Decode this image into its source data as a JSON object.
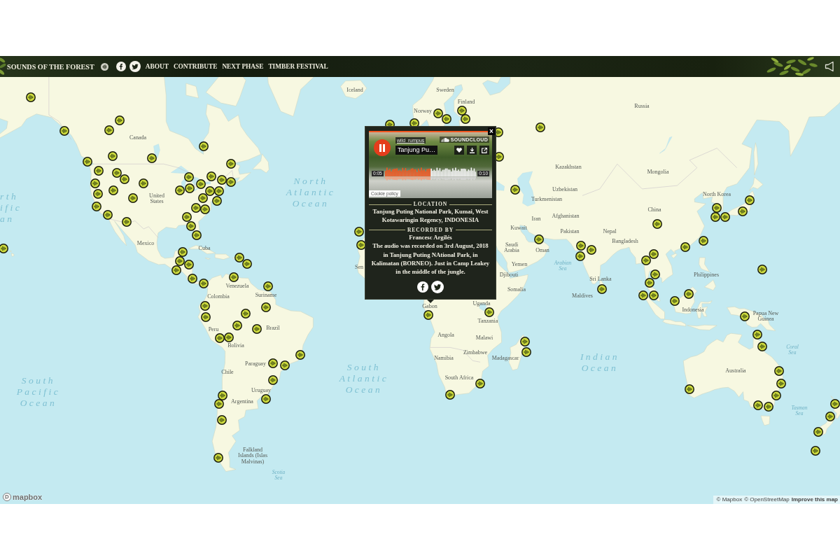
{
  "topbar": {
    "title": "SOUNDS OF THE FOREST",
    "nav": [
      {
        "label": "ABOUT"
      },
      {
        "label": "CONTRIBUTE"
      },
      {
        "label": "NEXT PHASE"
      },
      {
        "label": "TIMBER FESTIVAL"
      }
    ]
  },
  "map": {
    "labels": [
      {
        "text": "Iceland",
        "kind": "country"
      },
      {
        "text": "Sweden",
        "kind": "country"
      },
      {
        "text": "Finland",
        "kind": "country"
      },
      {
        "text": "Russia",
        "kind": "country"
      },
      {
        "text": "Norway",
        "kind": "country"
      },
      {
        "text": "Canada",
        "kind": "country"
      },
      {
        "text": "Kazakhstan",
        "kind": "country"
      },
      {
        "text": "Mongolia",
        "kind": "country"
      },
      {
        "text": "Uzbekistan",
        "kind": "country"
      },
      {
        "text": "United States",
        "kind": "country"
      },
      {
        "text": "North Atlantic Ocean",
        "kind": "ocean"
      },
      {
        "text": "North Korea",
        "kind": "country"
      },
      {
        "text": "Turkmenistan",
        "kind": "country"
      },
      {
        "text": "rth ific an",
        "kind": "ocean"
      },
      {
        "text": "China",
        "kind": "country"
      },
      {
        "text": "Iran",
        "kind": "country"
      },
      {
        "text": "Afghanistan",
        "kind": "country"
      },
      {
        "text": "Kuwait",
        "kind": "country"
      },
      {
        "text": "Pakistan",
        "kind": "country"
      },
      {
        "text": "Nepal",
        "kind": "country"
      },
      {
        "text": "Mexico",
        "kind": "country"
      },
      {
        "text": "Cuba",
        "kind": "country"
      },
      {
        "text": "Bangladesh",
        "kind": "country"
      },
      {
        "text": "Saudi Arabia",
        "kind": "country"
      },
      {
        "text": "Oman",
        "kind": "country"
      },
      {
        "text": "Sen",
        "kind": "country"
      },
      {
        "text": "Yemen",
        "kind": "country"
      },
      {
        "text": "Arabian Sea",
        "kind": "sea"
      },
      {
        "text": "Djibouti",
        "kind": "country"
      },
      {
        "text": "Sri Lanka",
        "kind": "country"
      },
      {
        "text": "Philippines",
        "kind": "country"
      },
      {
        "text": "Venezuela",
        "kind": "country"
      },
      {
        "text": "Somalia",
        "kind": "country"
      },
      {
        "text": "Colombia",
        "kind": "country"
      },
      {
        "text": "Suriname",
        "kind": "country"
      },
      {
        "text": "Uganda",
        "kind": "country"
      },
      {
        "text": "Maldives",
        "kind": "country"
      },
      {
        "text": "Gabon",
        "kind": "country"
      },
      {
        "text": "Indonesia",
        "kind": "country"
      },
      {
        "text": "Tanzania",
        "kind": "country"
      },
      {
        "text": "Papua New Guinea",
        "kind": "country"
      },
      {
        "text": "Peru",
        "kind": "country"
      },
      {
        "text": "Brazil",
        "kind": "country"
      },
      {
        "text": "Angola",
        "kind": "country"
      },
      {
        "text": "Malawi",
        "kind": "country"
      },
      {
        "text": "Bolivia",
        "kind": "country"
      },
      {
        "text": "Zimbabwe",
        "kind": "country"
      },
      {
        "text": "Coral Sea",
        "kind": "sea"
      },
      {
        "text": "Namibia",
        "kind": "country"
      },
      {
        "text": "Madagascar",
        "kind": "country"
      },
      {
        "text": "Paraguay",
        "kind": "country"
      },
      {
        "text": "Indian Ocean",
        "kind": "ocean"
      },
      {
        "text": "Chile",
        "kind": "country"
      },
      {
        "text": "Australia",
        "kind": "country"
      },
      {
        "text": "South Pacific Ocean",
        "kind": "ocean"
      },
      {
        "text": "South Atlantic Ocean",
        "kind": "ocean"
      },
      {
        "text": "South Africa",
        "kind": "country"
      },
      {
        "text": "Uruguay",
        "kind": "country"
      },
      {
        "text": "Argentina",
        "kind": "country"
      },
      {
        "text": "Tasman Sea",
        "kind": "sea"
      },
      {
        "text": "Falkland Islands (Islas Malvinas)",
        "kind": "country"
      },
      {
        "text": "Scotia Sea",
        "kind": "sea"
      }
    ]
  },
  "popup": {
    "close": "×",
    "player": {
      "user": "wild_rumpus",
      "title": "Tanjung Pu…",
      "brand": "SOUNDCLOUD",
      "playing": true,
      "elapsed": "0:05",
      "duration": "0:10",
      "level": 0.5,
      "cookie": "Cookie policy"
    },
    "location_heading": "LOCATION",
    "location": "Tanjung Puting National Park, Kumai, West Kotawaringin Regency, INDONESIA",
    "recorded_heading": "RECORDED BY",
    "recorder": "Francesc Argilés",
    "description": "The audio was recorded on 3rd August, 2018 in Tanjung Puting NAtional Park, in Kalimatan (BORNEO). Just in Camp Leakey in the middle of the jungle."
  },
  "attribution": {
    "logo": "mapbox",
    "links": [
      {
        "text": "© Mapbox",
        "kind": "credit"
      },
      {
        "text": "© OpenStreetMap",
        "kind": "credit"
      },
      {
        "text": "Improve this map",
        "kind": "action"
      }
    ]
  }
}
